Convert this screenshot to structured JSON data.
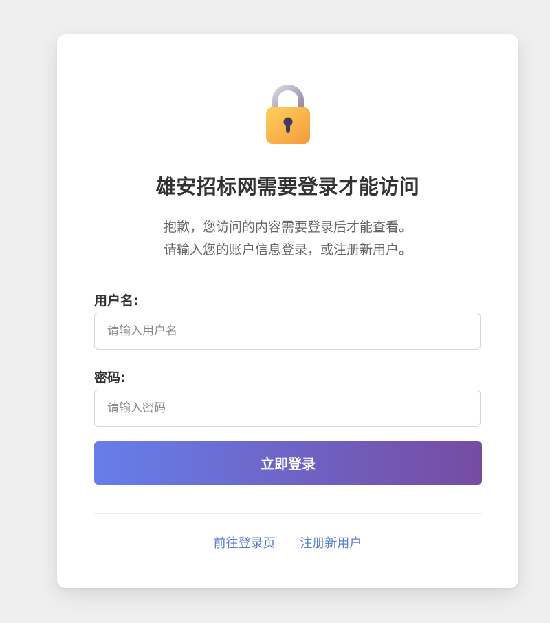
{
  "page": {
    "title": "雄安招标网需要登录才能访问",
    "description_line1": "抱歉，您访问的内容需要登录后才能查看。",
    "description_line2": "请输入您的账户信息登录，或注册新用户。"
  },
  "form": {
    "username_label": "用户名:",
    "username_placeholder": "请输入用户名",
    "password_label": "密码:",
    "password_placeholder": "请输入密码",
    "submit_label": "立即登录"
  },
  "links": {
    "goto_login": "前往登录页",
    "register": "注册新用户"
  },
  "icons": {
    "lock": "lock-icon"
  },
  "colors": {
    "button_gradient_start": "#667eea",
    "button_gradient_end": "#764ba2",
    "link": "#5b7fd6",
    "title": "#333333",
    "text": "#666666"
  }
}
